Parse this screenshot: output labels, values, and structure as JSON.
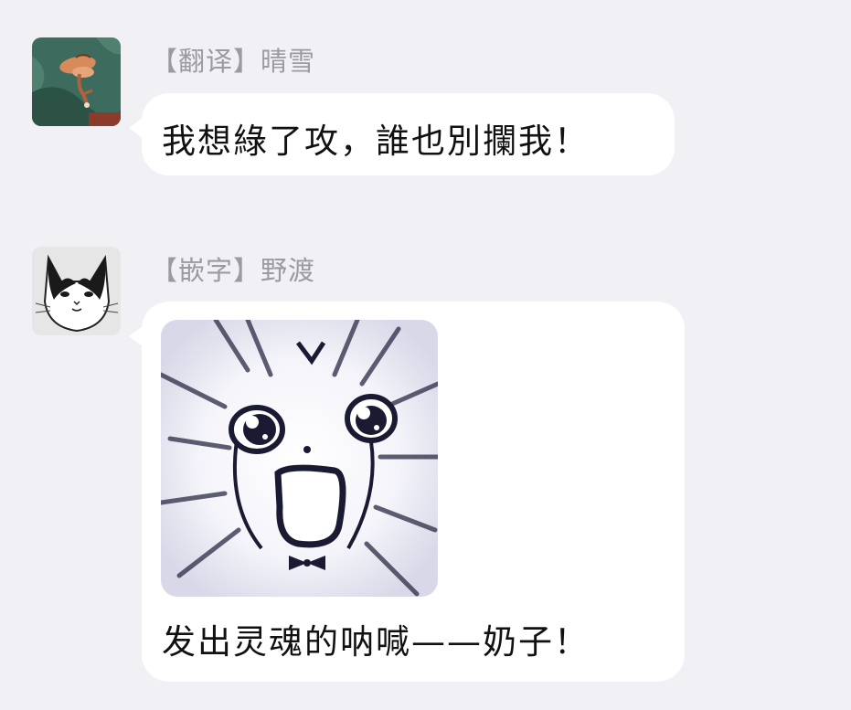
{
  "messages": [
    {
      "avatar_icon": "cartoon-figure-avatar",
      "sender": "【翻译】晴雪",
      "text": "我想綠了攻，誰也別攔我！"
    },
    {
      "avatar_icon": "black-white-cat-avatar",
      "sender": "【嵌字】野渡",
      "sticker_icon": "shocked-cat-sticker",
      "text": "发出灵魂的呐喊——奶子！"
    }
  ],
  "colors": {
    "background": "#f0f0f5",
    "bubble": "#ffffff",
    "sender_text": "#9a9aa0",
    "message_text": "#111111"
  }
}
